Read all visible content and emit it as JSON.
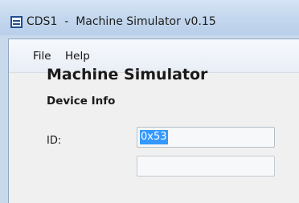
{
  "window": {
    "title": "CDS1  -  Machine Simulator v0.15",
    "icon": "app-window-icon"
  },
  "menu": {
    "items": [
      "File",
      "Help"
    ]
  },
  "main": {
    "app_title": "Machine Simulator",
    "section_title": "Device Info",
    "fields": [
      {
        "label": "ID:",
        "value": "0x53",
        "selected": true
      }
    ]
  },
  "colors": {
    "titlebar": "#c5d8ee",
    "client_background": "#f0f0f0",
    "selection": "#3399ff"
  }
}
